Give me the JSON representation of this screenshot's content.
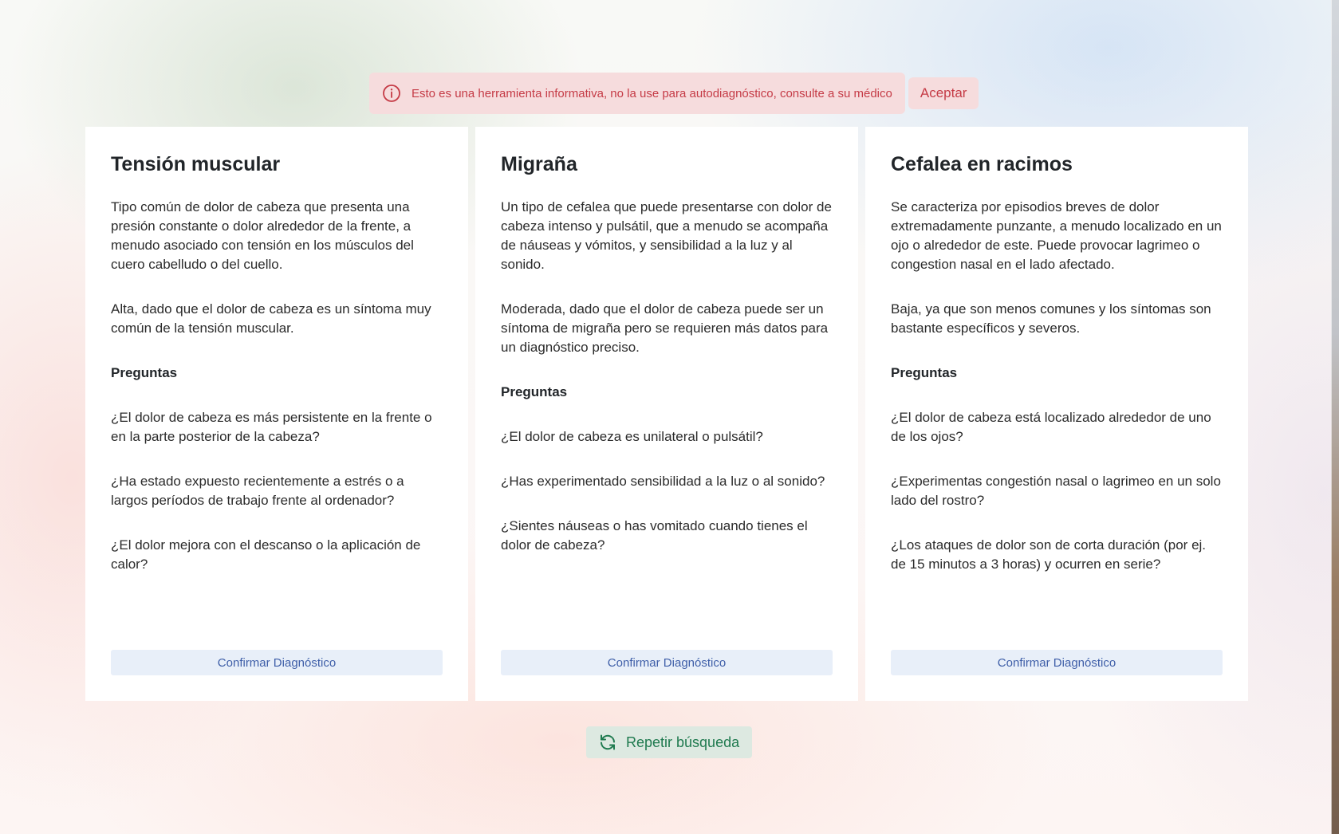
{
  "alert": {
    "message": "Esto es una herramienta informativa, no la use para autodiagnóstico, consulte a su médico",
    "accept_label": "Aceptar",
    "icon": "info-circle-icon",
    "color": "#c53b46"
  },
  "cards": [
    {
      "title": "Tensión muscular",
      "description": "Tipo común de dolor de cabeza que presenta una presión constante o dolor alrededor de la frente, a menudo asociado con tensión en los músculos del cuero cabelludo o del cuello.",
      "probability": "Alta, dado que el dolor de cabeza es un síntoma muy común de la tensión muscular.",
      "questions_heading": "Preguntas",
      "questions": [
        "¿El dolor de cabeza es más persistente en la frente o en la parte posterior de la cabeza?",
        "¿Ha estado expuesto recientemente a estrés o a largos períodos de trabajo frente al ordenador?",
        "¿El dolor mejora con el descanso o la aplicación de calor?"
      ],
      "confirm_label": "Confirmar Diagnóstico"
    },
    {
      "title": "Migraña",
      "description": "Un tipo de cefalea que puede presentarse con dolor de cabeza intenso y pulsátil, que a menudo se acompaña de náuseas y vómitos, y sensibilidad a la luz y al sonido.",
      "probability": "Moderada, dado que el dolor de cabeza puede ser un síntoma de migraña pero se requieren más datos para un diagnóstico preciso.",
      "questions_heading": "Preguntas",
      "questions": [
        "¿El dolor de cabeza es unilateral o pulsátil?",
        "¿Has experimentado sensibilidad a la luz o al sonido?",
        "¿Sientes náuseas o has vomitado cuando tienes el dolor de cabeza?"
      ],
      "confirm_label": "Confirmar Diagnóstico"
    },
    {
      "title": "Cefalea en racimos",
      "description": "Se caracteriza por episodios breves de dolor extremadamente punzante, a menudo localizado en un ojo o alrededor de este. Puede provocar lagrimeo o congestion nasal en el lado afectado.",
      "probability": "Baja, ya que son menos comunes y los síntomas son bastante específicos y severos.",
      "questions_heading": "Preguntas",
      "questions": [
        "¿El dolor de cabeza está localizado alrededor de uno de los ojos?",
        "¿Experimentas congestión nasal o lagrimeo en un solo lado del rostro?",
        "¿Los ataques de dolor son de corta duración (por ej. de 15 minutos a 3 horas) y ocurren en serie?"
      ],
      "confirm_label": "Confirmar Diagnóstico"
    }
  ],
  "repeat": {
    "label": "Repetir búsqueda",
    "icon": "refresh-icon",
    "color": "#1f7a4f"
  },
  "colors": {
    "alert_bg": "#f6dcdd",
    "alert_text": "#c53b46",
    "confirm_bg": "#e8eff9",
    "confirm_text": "#3e5ea8",
    "repeat_bg": "#dde9e1",
    "repeat_text": "#1f7a4f"
  }
}
